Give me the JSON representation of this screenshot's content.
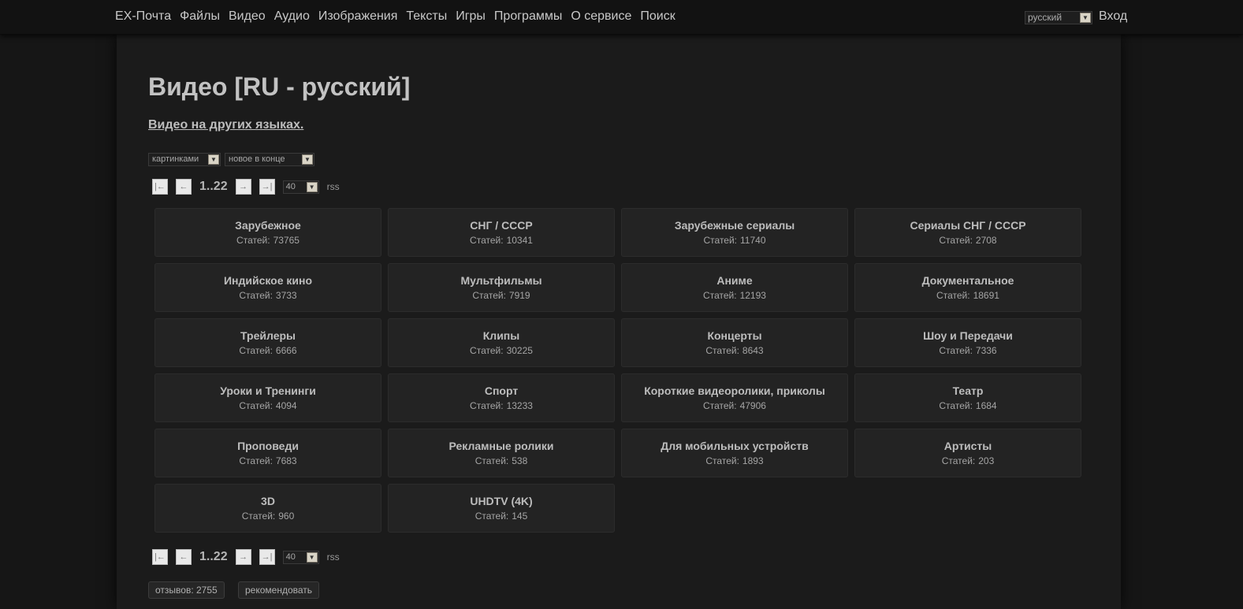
{
  "nav": {
    "logo": "EX-Почта",
    "items": [
      "Файлы",
      "Видео",
      "Аудио",
      "Изображения",
      "Тексты",
      "Игры",
      "Программы",
      "О сервисе",
      "Поиск"
    ],
    "language": "русский",
    "login": "Вход"
  },
  "page": {
    "title": "Видео [RU - русский]",
    "other_languages": "Видео на других языках.",
    "view_mode": "картинками",
    "sort_order": "новое в конце",
    "pages": "1..22",
    "per_page": "40",
    "rss": "rss"
  },
  "categories": [
    {
      "title": "Зарубежное",
      "label": "Статей:",
      "count": "73765"
    },
    {
      "title": "СНГ / СССР",
      "label": "Статей:",
      "count": "10341"
    },
    {
      "title": "Зарубежные сериалы",
      "label": "Статей:",
      "count": "11740"
    },
    {
      "title": "Сериалы СНГ / СССР",
      "label": "Статей:",
      "count": "2708"
    },
    {
      "title": "Индийское кино",
      "label": "Статей:",
      "count": "3733"
    },
    {
      "title": "Мультфильмы",
      "label": "Статей:",
      "count": "7919"
    },
    {
      "title": "Аниме",
      "label": "Статей:",
      "count": "12193"
    },
    {
      "title": "Документальное",
      "label": "Статей:",
      "count": "18691"
    },
    {
      "title": "Трейлеры",
      "label": "Статей:",
      "count": "6666"
    },
    {
      "title": "Клипы",
      "label": "Статей:",
      "count": "30225"
    },
    {
      "title": "Концерты",
      "label": "Статей:",
      "count": "8643"
    },
    {
      "title": "Шоу и Передачи",
      "label": "Статей:",
      "count": "7336"
    },
    {
      "title": "Уроки и Тренинги",
      "label": "Статей:",
      "count": "4094"
    },
    {
      "title": "Спорт",
      "label": "Статей:",
      "count": "13233"
    },
    {
      "title": "Короткие видеоролики, приколы",
      "label": "Статей:",
      "count": "47906"
    },
    {
      "title": "Театр",
      "label": "Статей:",
      "count": "1684"
    },
    {
      "title": "Проповеди",
      "label": "Статей:",
      "count": "7683"
    },
    {
      "title": "Рекламные ролики",
      "label": "Статей:",
      "count": "538"
    },
    {
      "title": "Для мобильных устройств",
      "label": "Статей:",
      "count": "1893"
    },
    {
      "title": "Артисты",
      "label": "Статей:",
      "count": "203"
    },
    {
      "title": "3D",
      "label": "Статей:",
      "count": "960"
    },
    {
      "title": "UHDTV (4K)",
      "label": "Статей:",
      "count": "145"
    }
  ],
  "footer": {
    "reviews": "отзывов: 2755",
    "recommend": "рекомендовать"
  }
}
